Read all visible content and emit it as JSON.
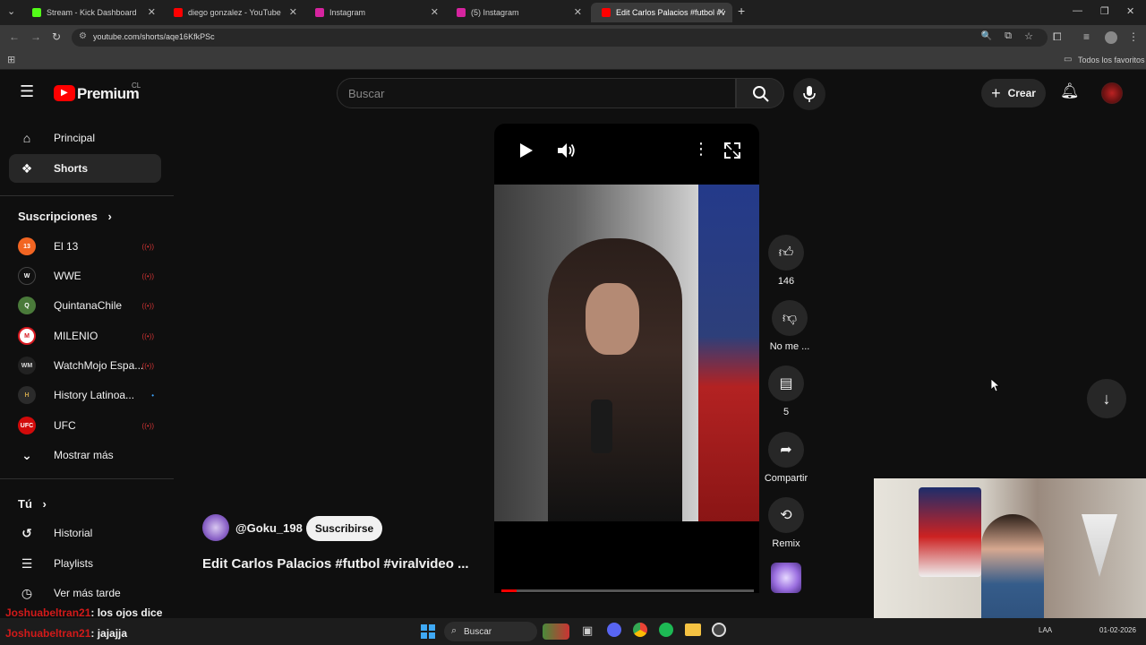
{
  "browser": {
    "tabs": [
      {
        "label": "Stream - Kick Dashboard",
        "favicon_color": "#53fc18"
      },
      {
        "label": "diego gonzalez - YouTube",
        "favicon_color": "#ff0000"
      },
      {
        "label": "Instagram",
        "favicon_color": "#d6249f"
      },
      {
        "label": "(5) Instagram",
        "favicon_color": "#d6249f"
      },
      {
        "label": "Edit Carlos Palacios #futbol #v",
        "favicon_color": "#ff0000"
      }
    ],
    "url": "youtube.com/shorts/aqe16KfkPSc",
    "bookmarks_label": "Todos los favoritos"
  },
  "header": {
    "logo_text": "Premium",
    "country": "CL",
    "search_placeholder": "Buscar",
    "create_label": "Crear"
  },
  "sidebar": {
    "main": [
      {
        "label": "Principal",
        "icon": "home-icon"
      },
      {
        "label": "Shorts",
        "icon": "shorts-icon"
      }
    ],
    "subs_title": "Suscripciones",
    "subscriptions": [
      {
        "label": "El 13",
        "color": "#f26522",
        "mark": "13"
      },
      {
        "label": "WWE",
        "color": "#111111",
        "mark": "W"
      },
      {
        "label": "QuintanaChile",
        "color": "#4a7a3a",
        "mark": "Q"
      },
      {
        "label": "MILENIO",
        "color": "#d71920",
        "mark": "M"
      },
      {
        "label": "WatchMojo Espa...",
        "color": "#222222",
        "mark": "WM"
      },
      {
        "label": "History Latinoa...",
        "color": "#2b2b2b",
        "mark": "H"
      },
      {
        "label": "UFC",
        "color": "#d20a0a",
        "mark": "UFC"
      }
    ],
    "show_more": "Mostrar más",
    "you_title": "Tú",
    "you_items": [
      {
        "label": "Historial",
        "icon": "history-icon"
      },
      {
        "label": "Playlists",
        "icon": "playlist-icon"
      },
      {
        "label": "Ver más tarde",
        "icon": "clock-icon"
      }
    ]
  },
  "short": {
    "channel": "@Goku_198",
    "subscribe_label": "Suscribirse",
    "title": "Edit Carlos Palacios #futbol #viralvideo ...",
    "likes": "146",
    "dislike_label": "No me ...",
    "comments": "5",
    "share_label": "Compartir",
    "remix_label": "Remix"
  },
  "chat": [
    {
      "user": "Joshuabeltran21",
      "text": ": los ojos dice"
    },
    {
      "user": "Joshuabeltran21",
      "text": ": jajajja"
    }
  ],
  "taskbar": {
    "search_label": "Buscar",
    "lang": "LAA",
    "date": "01-02-2026"
  }
}
